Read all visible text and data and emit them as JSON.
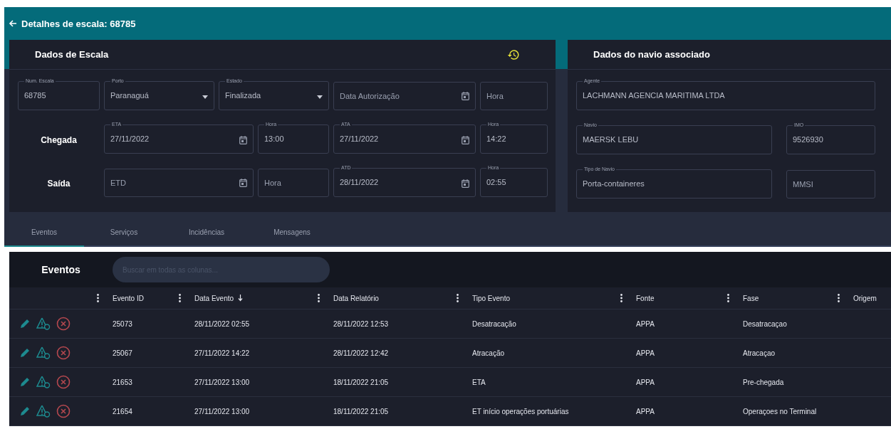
{
  "title": "Detalhes de escala: 68785",
  "escala": {
    "title": "Dados de Escala",
    "top_fields": [
      {
        "label": "Num. Escala",
        "value": "68785",
        "kind": "text"
      },
      {
        "label": "Porto",
        "value": "Paranaguá",
        "kind": "select"
      },
      {
        "label": "Estado",
        "value": "Finalizada",
        "kind": "select"
      },
      {
        "placeholder": "Data Autorização",
        "kind": "date"
      },
      {
        "placeholder": "Hora",
        "kind": "text"
      }
    ],
    "rows": [
      {
        "label": "Chegada",
        "fields": [
          {
            "label": "ETA",
            "value": "27/11/2022",
            "kind": "date"
          },
          {
            "label": "Hora",
            "value": "13:00",
            "kind": "text"
          },
          {
            "label": "ATA",
            "value": "27/11/2022",
            "kind": "date"
          },
          {
            "label": "Hora",
            "value": "14:22",
            "kind": "text"
          }
        ]
      },
      {
        "label": "Saída",
        "fields": [
          {
            "placeholder": "ETD",
            "kind": "date"
          },
          {
            "placeholder": "Hora",
            "kind": "text"
          },
          {
            "label": "ATD",
            "value": "28/11/2022",
            "kind": "date"
          },
          {
            "label": "Hora",
            "value": "02:55",
            "kind": "text"
          }
        ]
      }
    ]
  },
  "navio": {
    "title": "Dados do navio associado",
    "fields": [
      {
        "label": "Agente",
        "value": "LACHMANN AGENCIA MARITIMA LTDA"
      },
      {
        "label": "Navio",
        "value": "MAERSK LEBU"
      },
      {
        "label": "IMO",
        "value": "9526930"
      },
      {
        "label": "Tipo de Navio",
        "value": "Porta-containeres"
      },
      {
        "placeholder": "MMSI"
      }
    ]
  },
  "tabs": [
    {
      "label": "Eventos",
      "selected": true
    },
    {
      "label": "Serviços",
      "selected": false
    },
    {
      "label": "Incidências",
      "selected": false
    },
    {
      "label": "Mensagens",
      "selected": false
    }
  ],
  "table": {
    "title": "Eventos",
    "search": {
      "placeholder": "Buscar em todas as colunas..."
    },
    "columns": [
      {
        "label": "Evento ID",
        "sorted_desc": false
      },
      {
        "label": "Data Evento",
        "sorted_desc": true
      },
      {
        "label": "Data Relatório",
        "sorted_desc": false
      },
      {
        "label": "Tipo Evento",
        "sorted_desc": false
      },
      {
        "label": "Fonte",
        "sorted_desc": false
      },
      {
        "label": "Fase",
        "sorted_desc": false
      },
      {
        "label": "Origem",
        "sorted_desc": false
      }
    ],
    "rows": [
      [
        "25073",
        "28/11/2022 02:55",
        "28/11/2022 12:53",
        "Desatracação",
        "APPA",
        "Desatracaçao"
      ],
      [
        "25067",
        "27/11/2022 14:22",
        "28/11/2022 12:42",
        "Atracação",
        "APPA",
        "Atracaçao"
      ],
      [
        "21653",
        "27/11/2022 13:00",
        "18/11/2022 21:05",
        "ETA",
        "APPA",
        "Pre-chegada"
      ],
      [
        "21654",
        "27/11/2022 13:00",
        "18/11/2022 21:05",
        "ET início operações portuárias",
        "APPA",
        "Operaçoes no Terminal"
      ]
    ]
  }
}
